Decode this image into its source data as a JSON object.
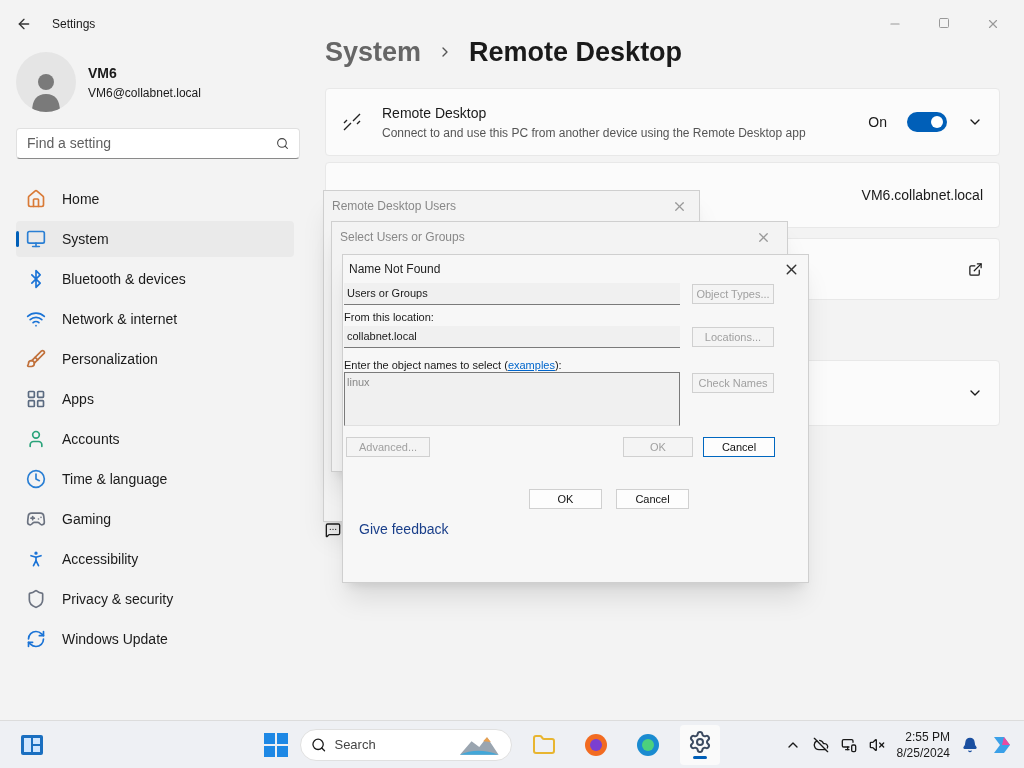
{
  "app": {
    "title": "Settings"
  },
  "profile": {
    "name": "VM6",
    "email": "VM6@collabnet.local"
  },
  "search": {
    "placeholder": "Find a setting"
  },
  "nav": [
    {
      "label": "Home",
      "selected": false
    },
    {
      "label": "System",
      "selected": true
    },
    {
      "label": "Bluetooth & devices",
      "selected": false
    },
    {
      "label": "Network & internet",
      "selected": false
    },
    {
      "label": "Personalization",
      "selected": false
    },
    {
      "label": "Apps",
      "selected": false
    },
    {
      "label": "Accounts",
      "selected": false
    },
    {
      "label": "Time & language",
      "selected": false
    },
    {
      "label": "Gaming",
      "selected": false
    },
    {
      "label": "Accessibility",
      "selected": false
    },
    {
      "label": "Privacy & security",
      "selected": false
    },
    {
      "label": "Windows Update",
      "selected": false
    }
  ],
  "breadcrumb": {
    "parent": "System",
    "current": "Remote Desktop"
  },
  "remote_desktop": {
    "title": "Remote Desktop",
    "description": "Connect to and use this PC from another device using the Remote Desktop app",
    "state_label": "On",
    "on": true
  },
  "pc_name": "VM6.collabnet.local",
  "feedback": "Give feedback",
  "dialogs": {
    "remote_users": {
      "title": "Remote Desktop Users",
      "ok": "OK",
      "cancel": "Cancel"
    },
    "select_users": {
      "title": "Select Users or Groups"
    },
    "name_not_found": {
      "title": "Name Not Found",
      "object_type": "Users or Groups",
      "object_types_button": "Object Types...",
      "location_label": "From this location:",
      "location": "collabnet.local",
      "locations_button": "Locations...",
      "names_label_before": "Enter the object names to select (",
      "names_link": "examples",
      "names_label_after": "):",
      "names_value": "linux",
      "check_names_button": "Check Names",
      "advanced_button": "Advanced...",
      "ok": "OK",
      "cancel": "Cancel"
    }
  },
  "taskbar": {
    "search_placeholder": "Search",
    "apps": [
      {
        "active": false
      },
      {
        "active": false
      },
      {
        "active": false
      },
      {
        "active": true
      }
    ],
    "time": "2:55 PM",
    "date": "8/25/2024"
  }
}
